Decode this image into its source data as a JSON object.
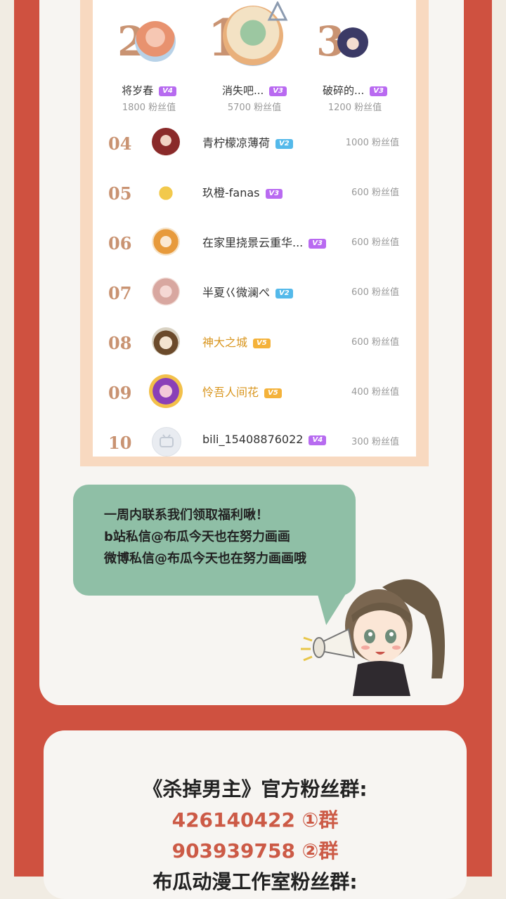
{
  "podium": [
    {
      "rank": "2",
      "name": "将岁春",
      "level": "V4",
      "fans": "1800 粉丝值"
    },
    {
      "rank": "1",
      "name": "消失吧...",
      "level": "V3",
      "fans": "5700 粉丝值"
    },
    {
      "rank": "3",
      "name": "破碎的...",
      "level": "V3",
      "fans": "1200 粉丝值"
    }
  ],
  "rows": [
    {
      "rank": "04",
      "name": "青柠檬凉薄荷",
      "level": "V2",
      "fans": "1000 粉丝值"
    },
    {
      "rank": "05",
      "name": "玖橙-fanas",
      "level": "V3",
      "fans": "600 粉丝值"
    },
    {
      "rank": "06",
      "name": "在家里挠景云重华...",
      "level": "V3",
      "fans": "600 粉丝值"
    },
    {
      "rank": "07",
      "name": "半夏巜微澜ぺ",
      "level": "V2",
      "fans": "600 粉丝值"
    },
    {
      "rank": "08",
      "name": "神大之城",
      "level": "V5",
      "fans": "600 粉丝值"
    },
    {
      "rank": "09",
      "name": "怜吾人间花",
      "level": "V5",
      "fans": "400 粉丝值"
    },
    {
      "rank": "10",
      "name": "bili_15408876022",
      "level": "V4",
      "fans": "300 粉丝值"
    }
  ],
  "bubble": {
    "line1": "一周内联系我们领取福利啾！",
    "line2": "b站私信@布瓜今天也在努力画画",
    "line3": "微博私信@布瓜今天也在努力画画哦"
  },
  "groups": {
    "title": "《杀掉男主》官方粉丝群:",
    "group1": "426140422 ①群",
    "group2": "903939758 ②群",
    "title2": "布瓜动漫工作室粉丝群:"
  },
  "colors": {
    "accent_red": "#cf5140",
    "rank_gold": "#c99372",
    "bubble_green": "#8fbfa6"
  }
}
